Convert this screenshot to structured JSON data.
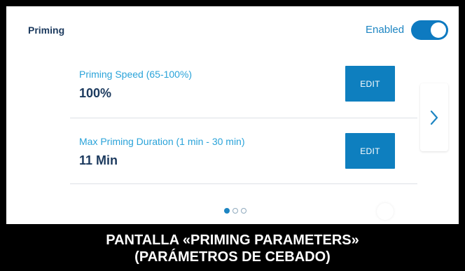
{
  "header": {
    "title": "Priming",
    "enabled_label": "Enabled",
    "toggle_on": true
  },
  "params": [
    {
      "label": "Priming Speed (65-100%)",
      "value": "100%",
      "edit_label": "EDIT"
    },
    {
      "label": "Max Priming Duration (1 min - 30 min)",
      "value": "11 Min",
      "edit_label": "EDIT"
    }
  ],
  "pager": {
    "current_page": 1,
    "total_pages": 3
  },
  "caption": {
    "line1": "PANTALLA «PRIMING PARAMETERS»",
    "line2": "(PARÁMETROS DE CEBADO)"
  },
  "colors": {
    "accent": "#0e7fbf",
    "label_blue": "#2aa3d9",
    "title_navy": "#1c3a5e",
    "background": "#ffffff",
    "frame": "#000000"
  },
  "icons": {
    "next": "chevron-right-icon"
  }
}
